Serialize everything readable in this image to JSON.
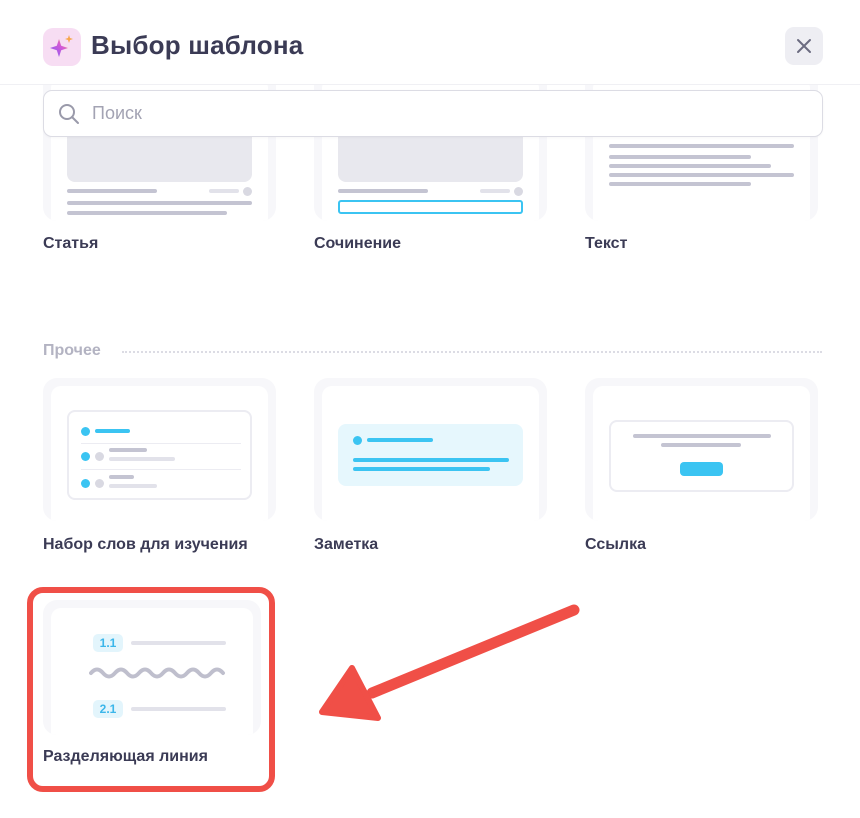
{
  "header": {
    "title": "Выбор шаблона",
    "icon": "sparkles-icon",
    "close_icon": "close-icon"
  },
  "search": {
    "placeholder": "Поиск",
    "value": ""
  },
  "templates_top": [
    {
      "label": "Статья"
    },
    {
      "label": "Сочинение"
    },
    {
      "label": "Текст"
    }
  ],
  "section": {
    "title": "Прочее"
  },
  "templates_other": [
    {
      "label": "Набор слов для изучения"
    },
    {
      "label": "Заметка"
    },
    {
      "label": "Ссылка"
    },
    {
      "label": "Разделяющая линия",
      "badges": [
        "1.1",
        "2.1"
      ]
    }
  ],
  "colors": {
    "accent": "#3bc4f2",
    "highlight": "#f04f47",
    "text": "#3b3b55"
  }
}
